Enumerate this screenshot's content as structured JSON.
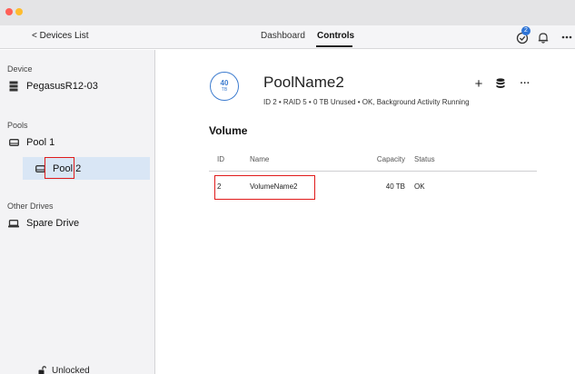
{
  "colors": {
    "accent": "#3d7ccf",
    "badge": "#2e74d6",
    "selection": "#d9e6f5",
    "highlight_box": "#e01b1b",
    "traffic_red": "#ff5f57",
    "traffic_yellow": "#febc2e"
  },
  "header": {
    "back_label": "< Devices List",
    "tabs": [
      {
        "label": "Dashboard",
        "active": false
      },
      {
        "label": "Controls",
        "active": true
      }
    ],
    "task_badge_count": "2",
    "icons": [
      "tasks-check-icon",
      "bell-icon",
      "more-icon"
    ]
  },
  "sidebar": {
    "device_label": "Device",
    "device_name": "PegasusR12-03",
    "pools_label": "Pools",
    "pools": [
      {
        "label": "Pool 1",
        "selected": false
      },
      {
        "label": "Pool 2",
        "selected": true
      }
    ],
    "other_label": "Other Drives",
    "other_items": [
      {
        "label": "Spare Drive"
      }
    ],
    "lock_status": "Unlocked"
  },
  "pool": {
    "capacity_value": "40",
    "capacity_unit": "TB",
    "name": "PoolName2",
    "info": "ID 2  •  RAID 5  •  0 TB Unused  •  OK, Background Activity Running",
    "actions": {
      "add_label": "+",
      "more_label": "···"
    }
  },
  "volume": {
    "title": "Volume",
    "columns": [
      "ID",
      "Name",
      "Capacity",
      "Status"
    ],
    "rows": [
      {
        "id": "2",
        "name": "VolumeName2",
        "capacity": "40 TB",
        "status": "OK"
      }
    ]
  }
}
